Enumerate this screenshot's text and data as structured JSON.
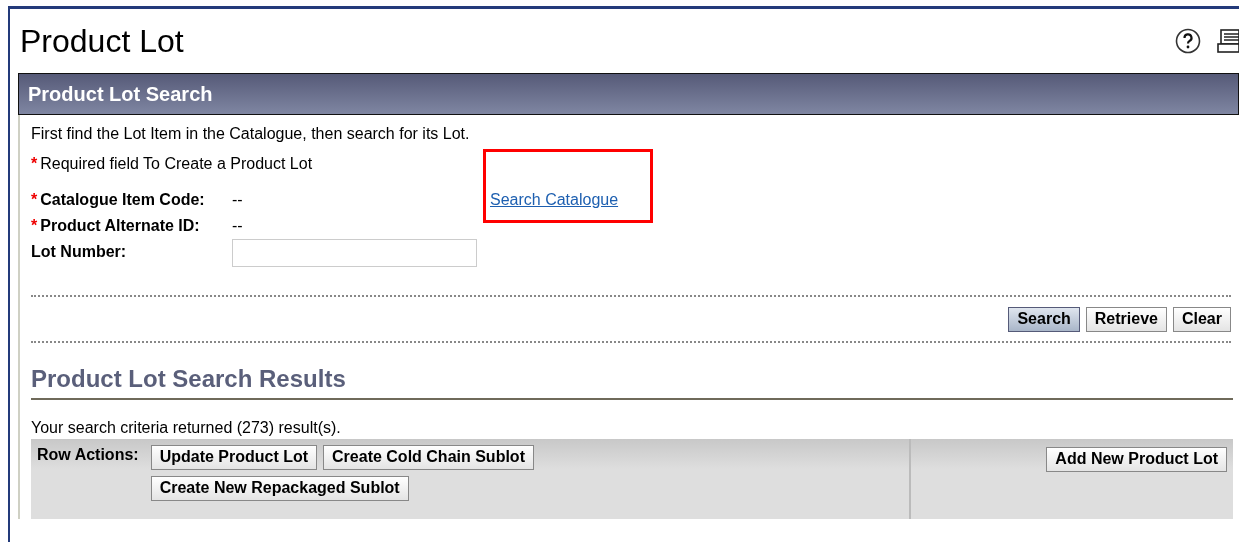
{
  "page": {
    "title": "Product Lot"
  },
  "panel": {
    "title": "Product Lot Search",
    "intro": "First find the Lot Item in the Catalogue, then search for its Lot.",
    "required_mark": "*",
    "required_note": "Required field To Create a Product Lot",
    "fields": [
      {
        "kind": "readonly",
        "label": "Catalogue Item Code:",
        "required": true,
        "value": "--"
      },
      {
        "kind": "readonly",
        "label": "Product Alternate ID:",
        "required": true,
        "value": "--"
      },
      {
        "kind": "input",
        "label": "Lot Number:",
        "required": false
      }
    ],
    "link": {
      "label": "Search Catalogue",
      "highlighted": true
    },
    "buttons": [
      {
        "label": "Search",
        "default": true
      },
      {
        "label": "Retrieve",
        "default": false
      },
      {
        "label": "Clear",
        "default": false
      }
    ]
  },
  "results": {
    "title": "Product Lot Search Results",
    "summary": "Your search criteria returned (273) result(s).",
    "row_actions_label": "Row Actions:",
    "row_actions": [
      "Update Product Lot",
      "Create Cold Chain Sublot",
      "Create New Repackaged Sublot"
    ],
    "page_actions": [
      "Add New Product Lot"
    ]
  }
}
